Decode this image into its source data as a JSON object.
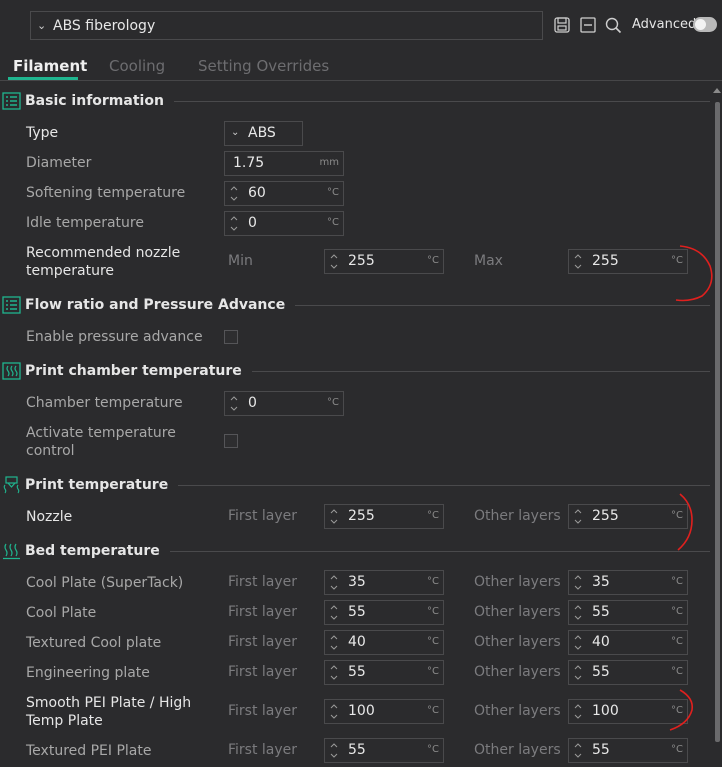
{
  "header": {
    "preset_name": "ABS fiberology",
    "advanced_label": "Advanced",
    "advanced_on": false
  },
  "tabs": [
    {
      "label": "Filament",
      "active": true
    },
    {
      "label": "Cooling",
      "active": false
    },
    {
      "label": "Setting Overrides",
      "active": false
    }
  ],
  "accent_color": "#1fb58f",
  "annotation_color": "#e0201e",
  "sections": {
    "basic": {
      "title": "Basic information",
      "type_label": "Type",
      "type_value": "ABS",
      "diameter_label": "Diameter",
      "diameter_value": "1.75",
      "diameter_unit": "mm",
      "softening_label": "Softening temperature",
      "softening_value": "60",
      "idle_label": "Idle temperature",
      "idle_value": "0",
      "nozzle_rec_label_1": "Recommended nozzle",
      "nozzle_rec_label_2": "temperature",
      "min_label": "Min",
      "min_value": "255",
      "max_label": "Max",
      "max_value": "255"
    },
    "flow": {
      "title": "Flow ratio and Pressure Advance",
      "pa_label": "Enable pressure advance",
      "pa_checked": false
    },
    "chamber": {
      "title": "Print chamber temperature",
      "chamber_label": "Chamber temperature",
      "chamber_value": "0",
      "activate_label_1": "Activate temperature",
      "activate_label_2": "control",
      "activate_checked": false
    },
    "print_temp": {
      "title": "Print temperature",
      "nozzle_label": "Nozzle",
      "first_layer_label": "First layer",
      "first_layer_value": "255",
      "other_layers_label": "Other layers",
      "other_layers_value": "255"
    },
    "bed": {
      "title": "Bed temperature",
      "first_layer_label": "First layer",
      "other_layers_label": "Other layers",
      "plates": [
        {
          "name_1": "Cool Plate (SuperTack)",
          "name_2": "",
          "first": "35",
          "other": "35"
        },
        {
          "name_1": "Cool Plate",
          "name_2": "",
          "first": "55",
          "other": "55"
        },
        {
          "name_1": "Textured Cool plate",
          "name_2": "",
          "first": "40",
          "other": "40"
        },
        {
          "name_1": "Engineering plate",
          "name_2": "",
          "first": "55",
          "other": "55"
        },
        {
          "name_1": "Smooth PEI Plate / High",
          "name_2": "Temp Plate",
          "first": "100",
          "other": "100"
        },
        {
          "name_1": "Textured PEI Plate",
          "name_2": "",
          "first": "55",
          "other": "55"
        }
      ]
    }
  },
  "unit_celsius": "°C",
  "icons": [
    "chevron-down-icon",
    "save-icon",
    "compare-icon",
    "search-icon",
    "list-icon",
    "spin-arrows-icon",
    "chamber-heat-icon",
    "nozzle-heat-icon",
    "bed-heat-icon"
  ]
}
